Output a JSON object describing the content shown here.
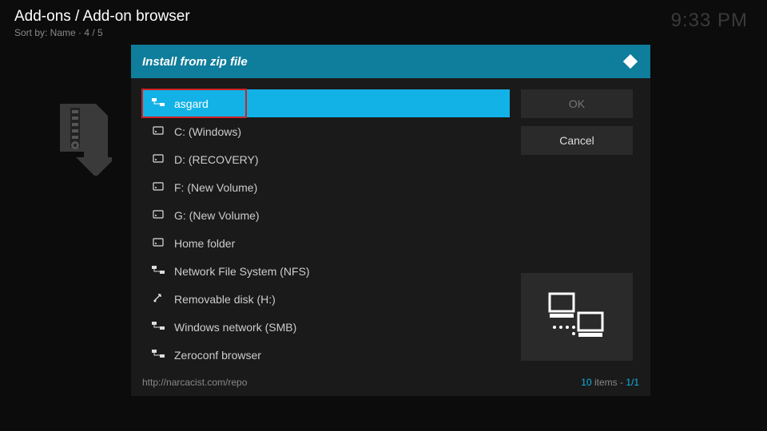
{
  "header": {
    "breadcrumb": "Add-ons / Add-on browser",
    "sort_line": "Sort by: Name  · 4 / 5"
  },
  "clock": "9:33 PM",
  "dialog": {
    "title": "Install from zip file",
    "items": [
      {
        "label": "asgard",
        "icon": "network",
        "selected": true
      },
      {
        "label": "C: (Windows)",
        "icon": "drive"
      },
      {
        "label": "D: (RECOVERY)",
        "icon": "drive"
      },
      {
        "label": "F: (New Volume)",
        "icon": "drive"
      },
      {
        "label": "G: (New Volume)",
        "icon": "drive"
      },
      {
        "label": "Home folder",
        "icon": "drive"
      },
      {
        "label": "Network File System (NFS)",
        "icon": "network"
      },
      {
        "label": "Removable disk (H:)",
        "icon": "usb"
      },
      {
        "label": "Windows network (SMB)",
        "icon": "network"
      },
      {
        "label": "Zeroconf browser",
        "icon": "network"
      }
    ],
    "ok_label": "OK",
    "cancel_label": "Cancel",
    "footer_path": "http://narcacist.com/repo",
    "footer_count": "10",
    "footer_items": " items - ",
    "footer_page": "1/1"
  }
}
